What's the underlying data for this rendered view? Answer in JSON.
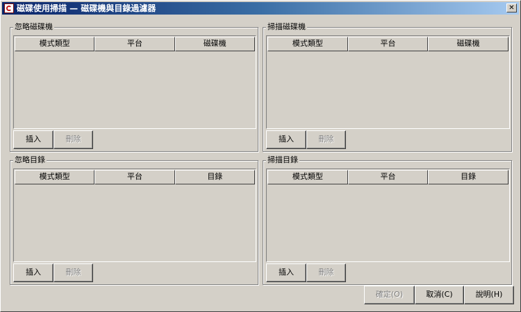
{
  "window": {
    "title": "磁碟使用掃描 — 磁碟機與目錄過濾器",
    "close_label": "✕"
  },
  "panels": {
    "ignore_drives": {
      "legend": "忽略磁碟機",
      "columns": [
        "模式類型",
        "平台",
        "磁碟機"
      ],
      "insert_label": "插入",
      "delete_label": "刪除"
    },
    "scan_drives": {
      "legend": "掃描磁碟機",
      "columns": [
        "模式類型",
        "平台",
        "磁碟機"
      ],
      "insert_label": "插入",
      "delete_label": "刪除"
    },
    "ignore_dirs": {
      "legend": "忽略目錄",
      "columns": [
        "模式類型",
        "平台",
        "目錄"
      ],
      "insert_label": "插入",
      "delete_label": "刪除"
    },
    "scan_dirs": {
      "legend": "掃描目錄",
      "columns": [
        "模式類型",
        "平台",
        "目錄"
      ],
      "insert_label": "插入",
      "delete_label": "刪除"
    }
  },
  "footer": {
    "ok_label": "確定(O)",
    "cancel_label": "取消(C)",
    "help_label": "說明(H)"
  }
}
